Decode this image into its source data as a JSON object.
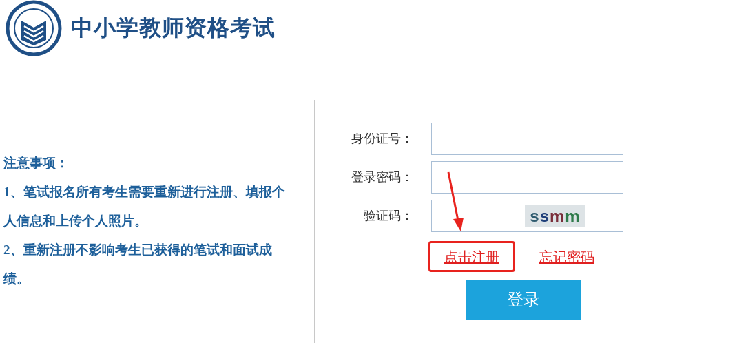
{
  "header": {
    "title": "中小学教师资格考试"
  },
  "notes": {
    "heading": "注意事项：",
    "items": [
      "1、笔试报名所有考生需要重新进行注册、填报个人信息和上传个人照片。",
      "2、重新注册不影响考生已获得的笔试和面试成绩。"
    ]
  },
  "login_form": {
    "fields": [
      {
        "label": "身份证号：",
        "kind": "text"
      },
      {
        "label": "登录密码：",
        "kind": "password"
      },
      {
        "label": "验证码：",
        "kind": "captcha",
        "captcha": "ssmm"
      }
    ],
    "links": [
      {
        "label": "点击注册",
        "highlighted": true
      },
      {
        "label": "忘记密码",
        "highlighted": false
      }
    ],
    "submit": "登录"
  }
}
